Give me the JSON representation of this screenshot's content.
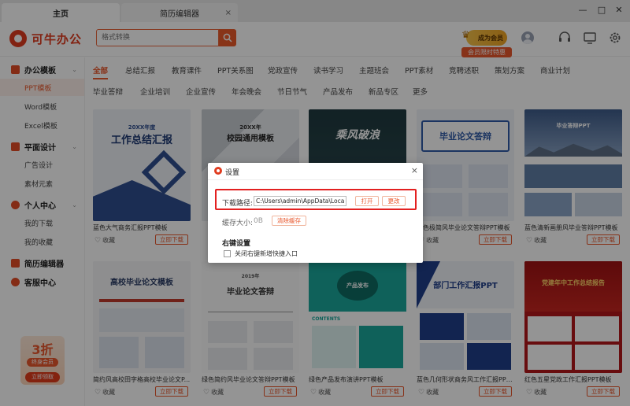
{
  "tabs": [
    {
      "label": "主页"
    },
    {
      "label": "简历编辑器",
      "close": "×"
    }
  ],
  "window_controls": {
    "minimize": "—",
    "maximize": "□",
    "close": "✕"
  },
  "header": {
    "logo_text": "可牛办公",
    "search_placeholder": "格式转换",
    "vip_button": "成为会员",
    "vip_banner": "会员限时特惠"
  },
  "sidebar": {
    "groups": [
      {
        "label": "办公模板",
        "chevron": "⌄"
      },
      {
        "label": "平面设计",
        "chevron": "⌄"
      },
      {
        "label": "个人中心",
        "chevron": "⌄"
      },
      {
        "label": "简历编辑器"
      },
      {
        "label": "客服中心"
      }
    ],
    "items": [
      {
        "label": "PPT模板",
        "active": true
      },
      {
        "label": "Word模板"
      },
      {
        "label": "Excel模板"
      },
      {
        "label": "广告设计"
      },
      {
        "label": "素材元素"
      },
      {
        "label": "我的下载"
      },
      {
        "label": "我的收藏"
      }
    ],
    "promo": {
      "discount": "3折",
      "sub": "终身会员",
      "button": "立即领取"
    }
  },
  "categories_row1": [
    "全部",
    "总结汇报",
    "教育课件",
    "PPT关系图",
    "党政宣传",
    "读书学习",
    "主题班会",
    "PPT素材",
    "竞聘述职",
    "策划方案",
    "商业计划"
  ],
  "categories_row2": [
    "毕业答辩",
    "企业培训",
    "企业宣传",
    "年会晚会",
    "节日节气",
    "产品发布",
    "新品专区",
    "更多"
  ],
  "cards": [
    {
      "title": "蓝色大气商务汇报PPT模板",
      "thumb_text": "工作总结汇报",
      "thumb_sub": "20XX年度"
    },
    {
      "title": "",
      "thumb_text": "校园通用模板",
      "thumb_sub": "20XX年"
    },
    {
      "title": "",
      "thumb_text": "乘风破浪",
      "thumb_sub": ""
    },
    {
      "title": "蓝色极简风毕业论文答辩PPT模板",
      "thumb_text": "毕业论文答辩",
      "thumb_sub": ""
    },
    {
      "title": "蓝色清新画册风毕业答辩PPT模板",
      "thumb_text": "毕业答辩PPT",
      "thumb_sub": ""
    },
    {
      "title": "简约风高校田字格高校毕业论文P...",
      "thumb_text": "高校毕业论文模板",
      "thumb_sub": ""
    },
    {
      "title": "绿色简约风毕业论文答辩PPT模板",
      "thumb_text": "毕业论文答辩",
      "thumb_sub": "2019年"
    },
    {
      "title": "绿色产品发布演讲PPT模板",
      "thumb_text": "产品发布",
      "thumb_sub": "CONTENTS"
    },
    {
      "title": "蓝色几何形状商务风工作汇报PPT...",
      "thumb_text": "部门工作汇报PPT",
      "thumb_sub": ""
    },
    {
      "title": "红色五星党政工作汇报PPT模板",
      "thumb_text": "党建年中工作总结报告",
      "thumb_sub": ""
    }
  ],
  "card_common": {
    "fav_label": "收藏",
    "download_label": "立即下载"
  },
  "dialog": {
    "title": "设置",
    "close": "×",
    "download_path_label": "下载路径:",
    "download_path_value": "C:\\Users\\admin\\AppData\\Local\\kr",
    "open_button": "打开",
    "change_button": "更改",
    "cache_label": "缓存大小:",
    "cache_value": "0B",
    "clear_cache_button": "清除缓存",
    "right_click_heading": "右键设置",
    "right_click_option": "关闭右键新增快捷入口"
  },
  "colors": {
    "accent": "#e8572c",
    "highlight": "#e32020"
  }
}
